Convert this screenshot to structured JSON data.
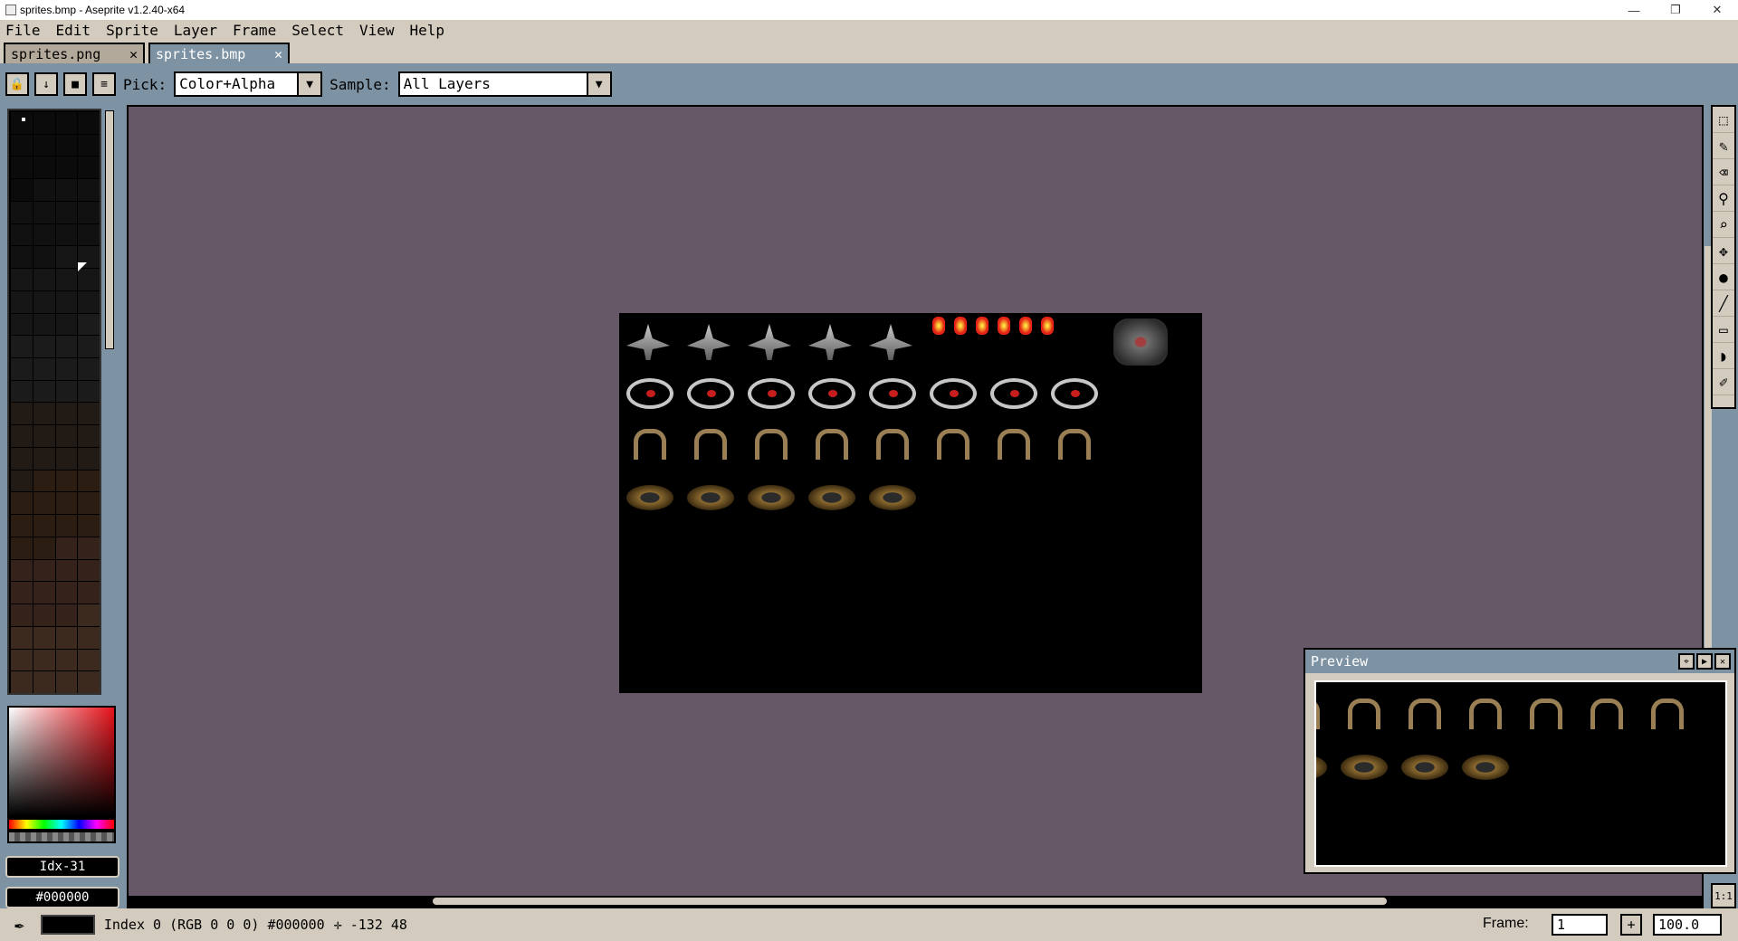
{
  "window": {
    "title": "sprites.bmp - Aseprite v1.2.40-x64",
    "minimize": "—",
    "maximize": "❐",
    "close": "✕"
  },
  "menu": {
    "items": [
      "File",
      "Edit",
      "Sprite",
      "Layer",
      "Frame",
      "Select",
      "View",
      "Help"
    ]
  },
  "tabs": [
    {
      "label": "sprites.png",
      "close": "✕"
    },
    {
      "label": "sprites.bmp",
      "close": "✕"
    }
  ],
  "context": {
    "pick_label": "Pick:",
    "pick_value": "Color+Alpha",
    "sample_label": "Sample:",
    "sample_value": "All Layers",
    "lock_icon": "lock-icon",
    "down_icon": "arrow-down-icon",
    "square_icon": "square-icon",
    "menu_icon": "menu-icon"
  },
  "color": {
    "index_label": "Idx-31",
    "hex_label": "#000000"
  },
  "preview": {
    "title": "Preview"
  },
  "status": {
    "text": "Index 0 (RGB 0 0 0) #000000",
    "coords": "✛ -132 48",
    "frame_label": "Frame:",
    "frame_value": "1",
    "frame_add": "+",
    "zoom_value": "100.0"
  },
  "toolbar_tools": [
    "marquee-icon",
    "pencil-icon",
    "eraser-icon",
    "eyedropper-icon",
    "zoom-icon",
    "move-icon",
    "fill-icon",
    "line-icon",
    "rectangle-icon",
    "blur-icon",
    "smudge-icon"
  ],
  "one_to_one": "1:1",
  "colors": {
    "editor_bg": "#665866",
    "ui_frame": "#7d92a3",
    "ui_face": "#d3cbbe"
  }
}
